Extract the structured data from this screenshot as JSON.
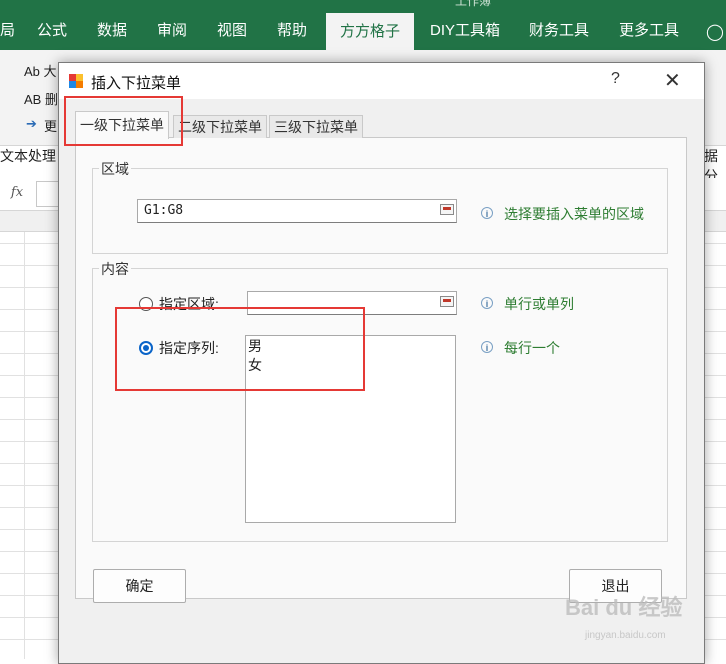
{
  "excel": {
    "title_hint": "工作簿",
    "ribbon_tabs": [
      "局",
      "公式",
      "数据",
      "审阅",
      "视图",
      "帮助",
      "方方格子",
      "DIY工具箱",
      "财务工具",
      "更多工具"
    ],
    "active_tab": "方方格子",
    "ribbon_left_items": [
      "Ab 大",
      "AB 删",
      "更"
    ],
    "group_label_left": "文本处理",
    "group_label_right": "据分",
    "fx_label": "fx"
  },
  "dialog": {
    "title": "插入下拉菜单",
    "help_glyph": "?",
    "close_glyph": "✕",
    "tabs": [
      "一级下拉菜单",
      "二级下拉菜单",
      "三级下拉菜单"
    ],
    "active_tab_index": 0,
    "region_group": {
      "title": "区域",
      "value": "G1:G8",
      "hint": "选择要插入菜单的区域"
    },
    "content_group": {
      "title": "内容",
      "option_range": {
        "label": "指定区域:",
        "value": "",
        "hint": "单行或单列",
        "checked": false
      },
      "option_sequence": {
        "label": "指定序列:",
        "lines": [
          "男",
          "女"
        ],
        "hint": "每行一个",
        "checked": true
      }
    },
    "ok_label": "确定",
    "cancel_label": "退出"
  },
  "watermark": {
    "text": "Bai du 经验",
    "sub": "jingyan.baidu.com"
  },
  "colors": {
    "excel_green": "#217346",
    "hint_green": "#2e7d32",
    "highlight_red": "#e53935",
    "radio_blue": "#0a64c8"
  }
}
